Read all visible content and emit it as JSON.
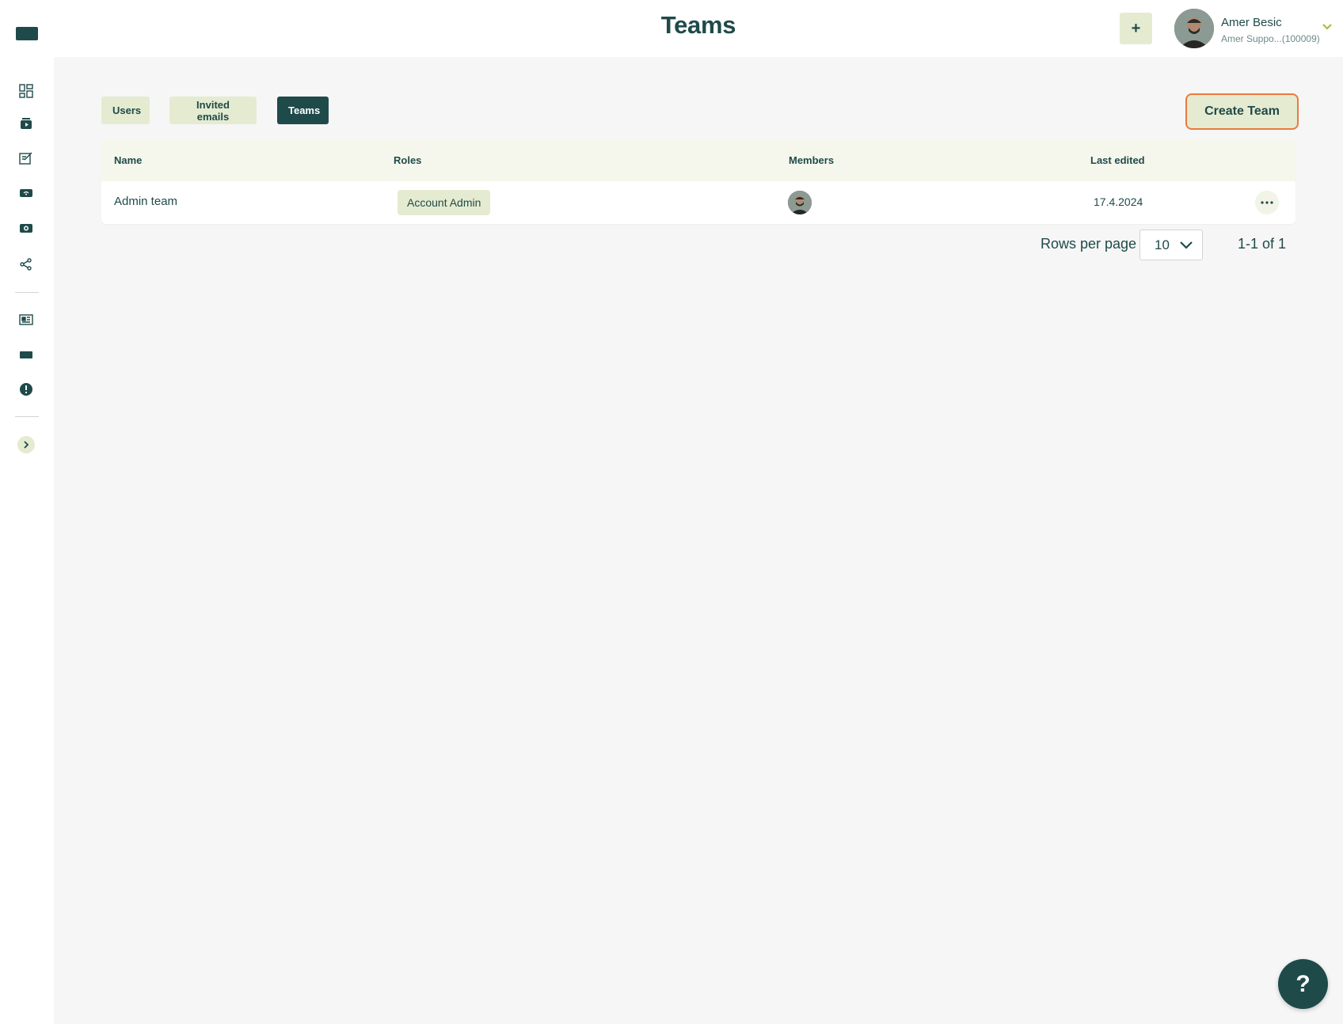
{
  "header": {
    "title": "Teams",
    "add_label": "+",
    "user": {
      "name": "Amer Besic",
      "organization": "Amer Suppo...(100009)"
    }
  },
  "tabs": [
    {
      "label": "Users",
      "active": false
    },
    {
      "label": "Invited emails",
      "active": false
    },
    {
      "label": "Teams",
      "active": true
    }
  ],
  "actions": {
    "create_team_label": "Create Team"
  },
  "table": {
    "columns": [
      "Name",
      "Roles",
      "Members",
      "Last edited"
    ],
    "rows": [
      {
        "name": "Admin team",
        "role": "Account Admin",
        "members": [
          "avatar"
        ],
        "last_edited": "17.4.2024"
      }
    ]
  },
  "pagination": {
    "rows_per_page_label": "Rows per page",
    "rows_per_page_value": "10",
    "range": "1-1 of 1"
  },
  "help": {
    "label": "?"
  },
  "colors": {
    "primary": "#1f4a4a",
    "accent_light": "#e5ebd0",
    "highlight": "#ec7a3c",
    "background": "#f6f6f6"
  },
  "sidebar_icons": [
    "dashboard-icon",
    "media-library-icon",
    "editor-icon",
    "wifi-device-icon",
    "camera-icon",
    "share-icon",
    "news-icon",
    "screen-icon",
    "alert-icon"
  ]
}
